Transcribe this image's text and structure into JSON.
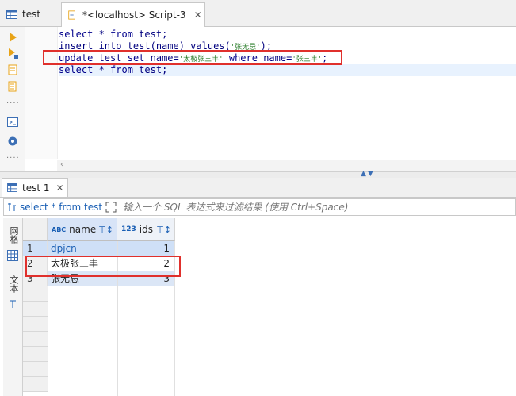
{
  "editor_tabs": [
    {
      "label": "test",
      "icon": "table-icon"
    },
    {
      "label": "*<localhost> Script-3",
      "icon": "script-icon",
      "close": "✕"
    }
  ],
  "left_toolbar": [
    "execute-icon",
    "execute-script-icon",
    "explain-icon",
    "export-icon",
    "terminal-icon",
    "settings-icon"
  ],
  "sql_lines": [
    {
      "kw1": "select",
      "rest": " * ",
      "kw2": "from",
      "tail": " test;"
    },
    {
      "text": "insert into test(name) values(",
      "str": "'张无忌'",
      "tail": ");"
    },
    {
      "kw1": "update",
      "mid1": " test ",
      "kw2": "set",
      "mid2": " name=",
      "str1": "'太极张三丰'",
      "mid3": " ",
      "kw3": "where",
      "mid4": " name=",
      "str2": "'张三丰'",
      "tail": ";"
    },
    {
      "kw1": "select",
      "rest": " * ",
      "kw2": "from",
      "tail": " test;"
    }
  ],
  "result_tab": {
    "label": "test 1",
    "close": "✕"
  },
  "filter_bar": {
    "query": "select * from test",
    "placeholder": "输入一个 SQL 表达式来过滤结果 (使用 Ctrl+Space)"
  },
  "side_panel": {
    "grid_label": "网格",
    "text_label": "文本"
  },
  "grid": {
    "columns": [
      {
        "name": "name",
        "type": "ABC"
      },
      {
        "name": "ids",
        "type": "123"
      }
    ],
    "rows": [
      {
        "num": "1",
        "name": "dpjcn",
        "ids": "1"
      },
      {
        "num": "2",
        "name": "太极张三丰",
        "ids": "2"
      },
      {
        "num": "3",
        "name": "张无忌",
        "ids": "3"
      }
    ]
  },
  "colors": {
    "highlight_box": "#e0302c",
    "accent": "#1a5fb4",
    "selection": "#cfe0f7"
  }
}
